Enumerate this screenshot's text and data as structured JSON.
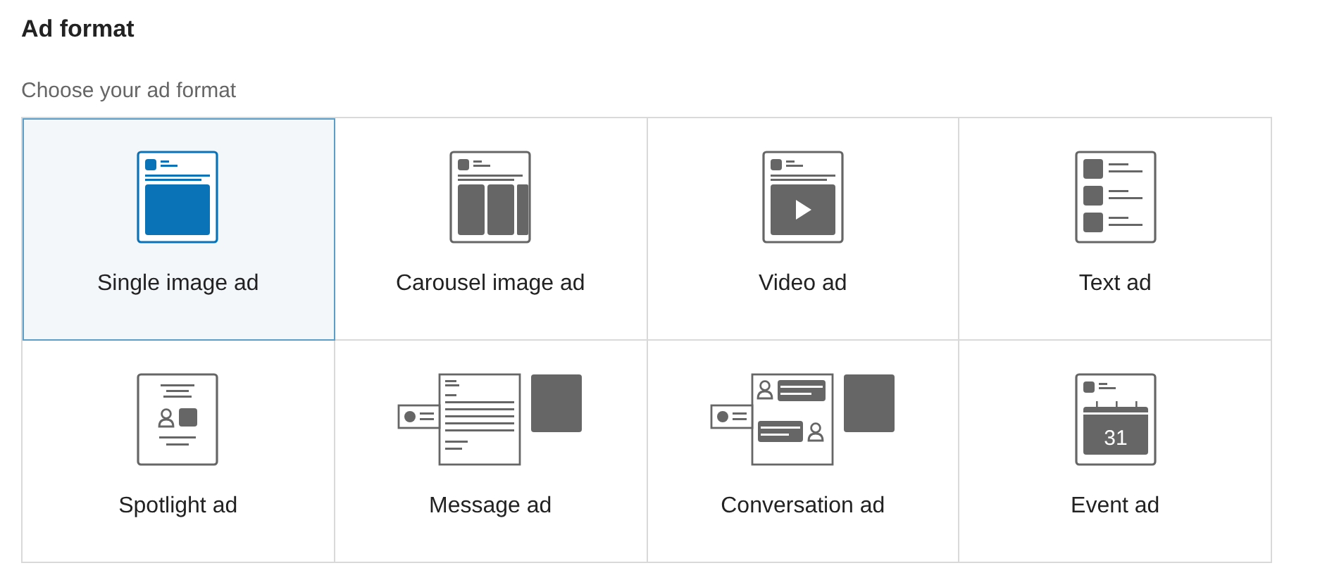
{
  "heading": "Ad format",
  "subheading": "Choose your ad format",
  "formats": [
    {
      "kind": "single",
      "label": "Single image ad",
      "selected": true
    },
    {
      "kind": "carousel",
      "label": "Carousel image ad",
      "selected": false
    },
    {
      "kind": "video",
      "label": "Video ad",
      "selected": false
    },
    {
      "kind": "text",
      "label": "Text ad",
      "selected": false
    },
    {
      "kind": "spotlight",
      "label": "Spotlight ad",
      "selected": false
    },
    {
      "kind": "message",
      "label": "Message ad",
      "selected": false
    },
    {
      "kind": "conversation",
      "label": "Conversation ad",
      "selected": false
    },
    {
      "kind": "event",
      "label": "Event ad",
      "selected": false,
      "icon_text": "31"
    }
  ]
}
